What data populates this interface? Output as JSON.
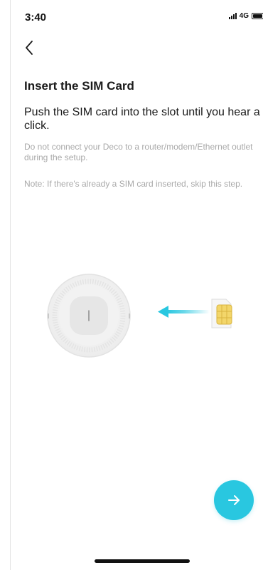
{
  "status_bar": {
    "time": "3:40",
    "network": "4G",
    "signal_icon": "signal-bars-icon",
    "battery_icon": "battery-icon"
  },
  "nav": {
    "back_icon": "chevron-left-icon"
  },
  "content": {
    "title": "Insert the SIM Card",
    "instruction": "Push the SIM card into the slot until you hear a click.",
    "note_1": "Do not connect your Deco to a router/modem/Ethernet outlet during the setup.",
    "note_2": "Note: If there's already a SIM card inserted, skip this step."
  },
  "illustration": {
    "device": "deco-device-bottom-view",
    "arrow": "arrow-left-icon",
    "sim": "sim-card-icon"
  },
  "actions": {
    "next_icon": "arrow-right-icon"
  },
  "colors": {
    "accent": "#29c7e0",
    "text_primary": "#1a1a1a",
    "text_secondary": "#a9a9a9",
    "sim_chip": "#f3d66a"
  }
}
